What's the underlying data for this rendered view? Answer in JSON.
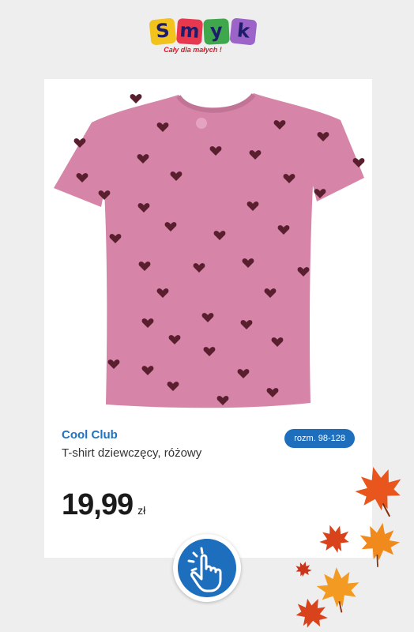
{
  "logo": {
    "letters": [
      "S",
      "m",
      "y",
      "k"
    ],
    "tagline": "Cały dla małych !",
    "tile_colors": [
      "#f2c21d",
      "#e8384f",
      "#3fa84c",
      "#9c64c8"
    ]
  },
  "product": {
    "brand": "Cool Club",
    "title": "T-shirt dziewczęcy, różowy",
    "size_badge": "rozm. 98-128",
    "price": "19,99",
    "currency": "zł",
    "shirt_color": "#d685a8",
    "heart_color": "#5a1f2e"
  },
  "cta": {
    "icon": "tap-hand-icon"
  },
  "colors": {
    "accent": "#1d6fbd",
    "background": "#eeeeee"
  }
}
